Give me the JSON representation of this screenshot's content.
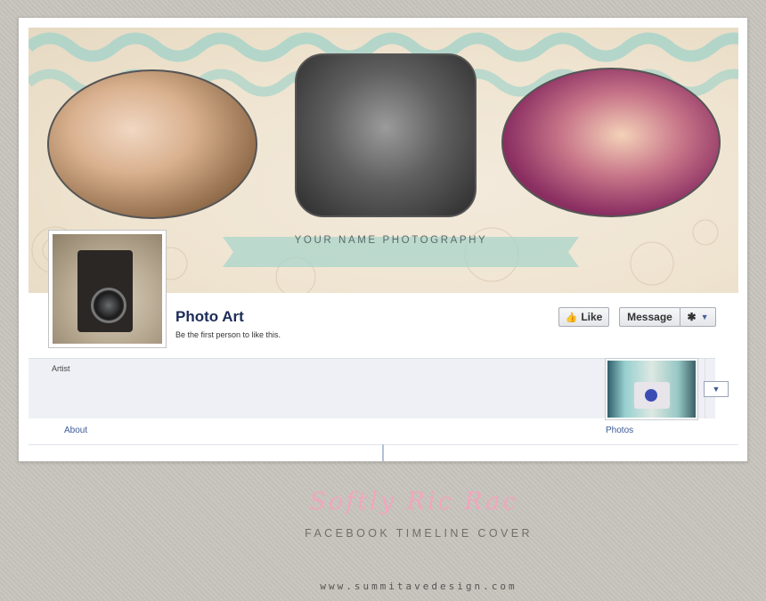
{
  "cover": {
    "tagline": "YOUR NAME PHOTOGRAPHY",
    "colors": {
      "accent_mint": "#a9d4c9",
      "paper": "#efe4d0"
    }
  },
  "profile": {
    "page_name": "Photo Art",
    "like_prompt": "Be the first person to like this.",
    "category": "Artist"
  },
  "actions": {
    "like_label": "Like",
    "message_label": "Message",
    "gear_icon": "gear-icon"
  },
  "tabs": {
    "about_label": "About",
    "photos_label": "Photos"
  },
  "branding": {
    "script_title": "Softly Ric Rac",
    "subtitle": "FACEBOOK TIMELINE COVER",
    "website": "www.summitavedesign.com",
    "colors": {
      "script_pink": "#f1a6bd",
      "link_blue": "#3b5998",
      "name_navy": "#1c2c58"
    }
  }
}
